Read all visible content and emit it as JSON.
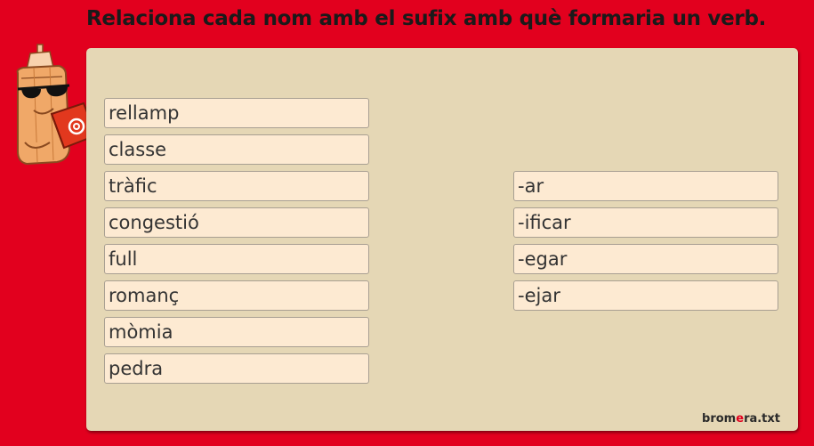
{
  "instruction": "Relaciona cada nom amb el sufix amb què formaria un verb.",
  "nouns": [
    "rellamp",
    "classe",
    "tràfic",
    "congestió",
    "full",
    "romanç",
    "mòmia",
    "pedra"
  ],
  "suffixes": [
    "-ar",
    "-ificar",
    "-egar",
    "-ejar"
  ],
  "brand": {
    "part1": "brom",
    "part2": "e",
    "part3": "ra.txt"
  },
  "colors": {
    "background": "#e2001e",
    "panel": "#e5d7b5",
    "card": "#fdead2"
  }
}
